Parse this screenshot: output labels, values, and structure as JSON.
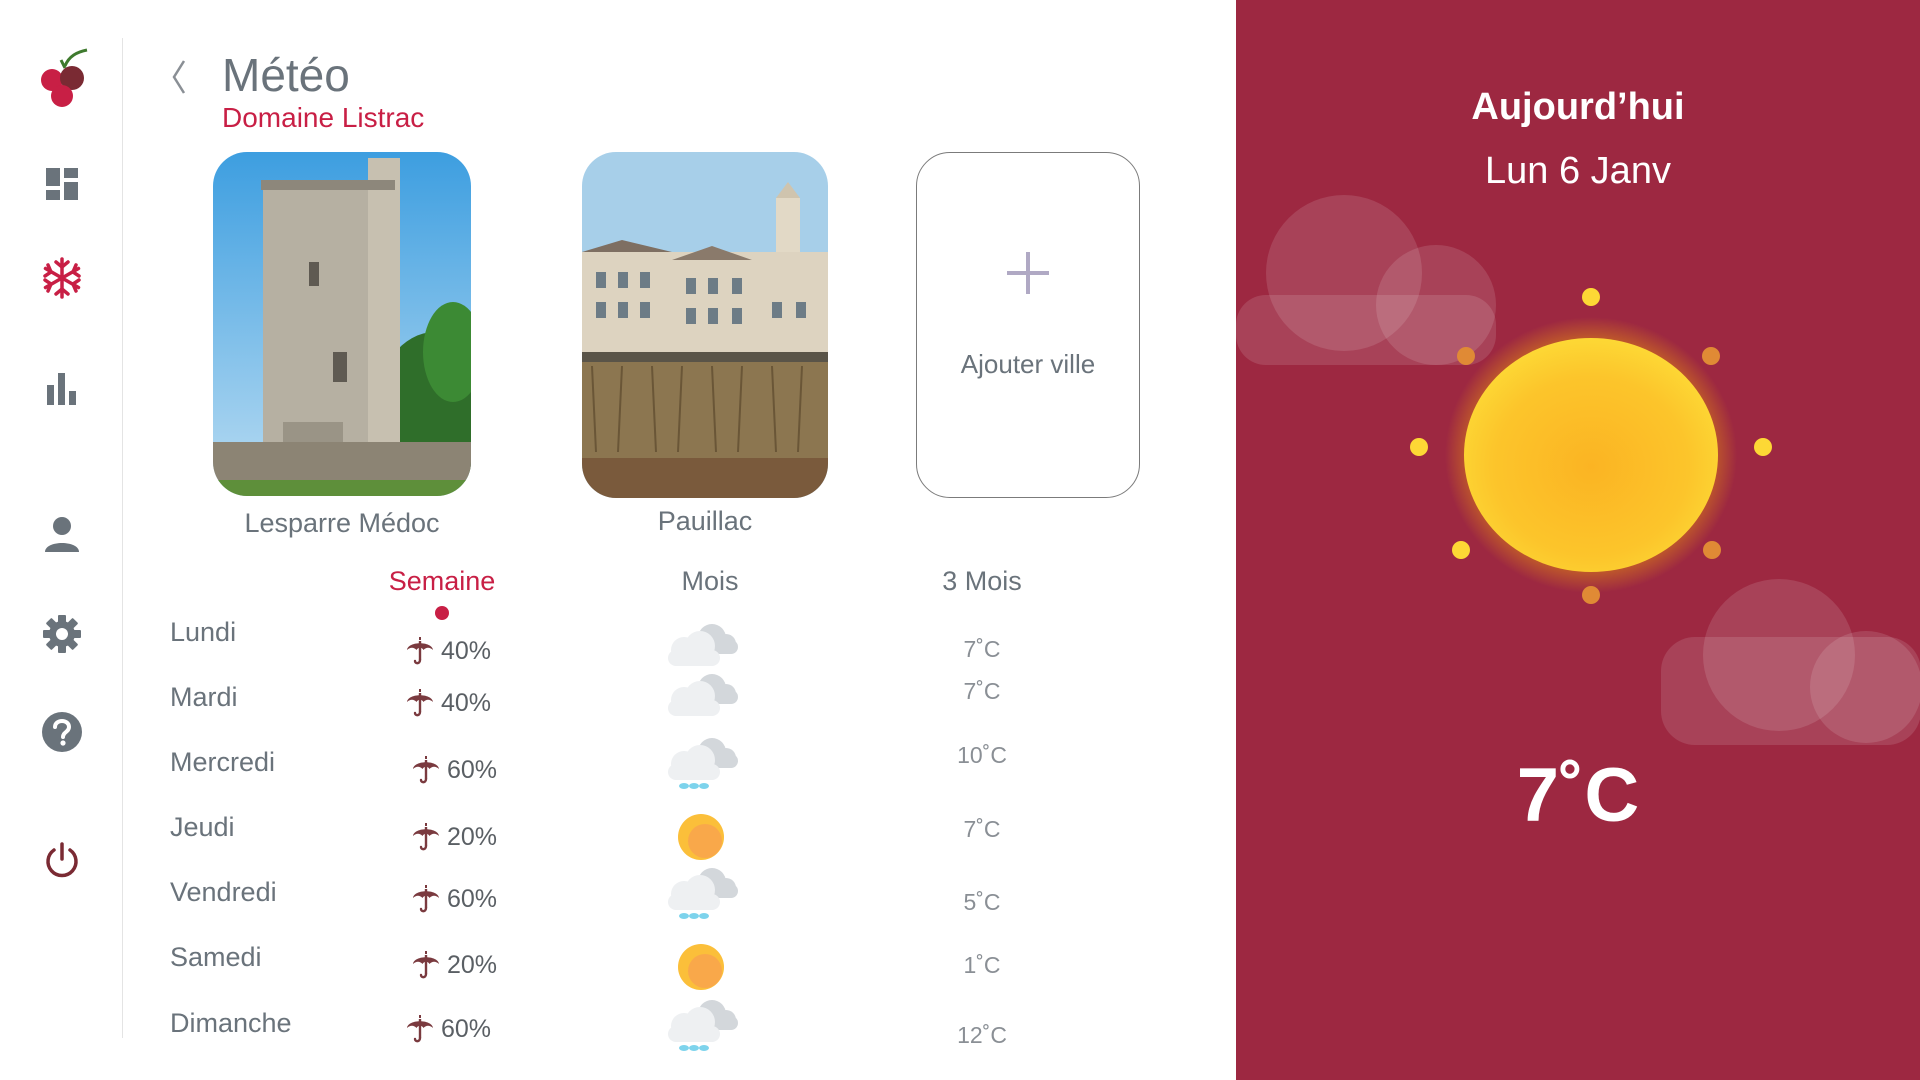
{
  "header": {
    "title": "Météo",
    "subtitle": "Domaine Listrac"
  },
  "sidebar": {
    "items": [
      {
        "name": "dashboard",
        "icon": "dashboard-icon"
      },
      {
        "name": "frost",
        "icon": "snowflake-icon",
        "active": true
      },
      {
        "name": "stats",
        "icon": "bar-chart-icon"
      },
      {
        "name": "profile",
        "icon": "user-icon"
      },
      {
        "name": "settings",
        "icon": "gear-icon"
      },
      {
        "name": "help",
        "icon": "help-icon"
      },
      {
        "name": "logout",
        "icon": "power-icon"
      }
    ]
  },
  "cities": [
    {
      "name": "Lesparre Médoc"
    },
    {
      "name": "Pauillac"
    }
  ],
  "add_city": {
    "label": "Ajouter ville"
  },
  "tabs": [
    {
      "label": "Semaine",
      "active": true
    },
    {
      "label": "Mois",
      "active": false
    },
    {
      "label": "3 Mois",
      "active": false
    }
  ],
  "forecast": [
    {
      "day": "Lundi",
      "rain": "40%",
      "weather": "cloudy-icon",
      "temp": "7˚C"
    },
    {
      "day": "Mardi",
      "rain": "40%",
      "weather": "cloudy-icon",
      "temp": "7˚C"
    },
    {
      "day": "Mercredi",
      "rain": "60%",
      "weather": "rain-cloud-icon",
      "temp": "10˚C"
    },
    {
      "day": "Jeudi",
      "rain": "20%",
      "weather": "sun-icon",
      "temp": "7˚C"
    },
    {
      "day": "Vendredi",
      "rain": "60%",
      "weather": "rain-cloud-icon",
      "temp": "5˚C"
    },
    {
      "day": "Samedi",
      "rain": "20%",
      "weather": "sun-icon",
      "temp": "1˚C"
    },
    {
      "day": "Dimanche",
      "rain": "60%",
      "weather": "rain-cloud-icon",
      "temp": "12˚C"
    }
  ],
  "today": {
    "title": "Aujourd’hui",
    "date": "Lun 6 Janv",
    "temperature": "7˚C",
    "weather": "sun-icon"
  },
  "colors": {
    "accent": "#c81f45",
    "panel": "#9d2841",
    "text_gray": "#6a737b"
  }
}
